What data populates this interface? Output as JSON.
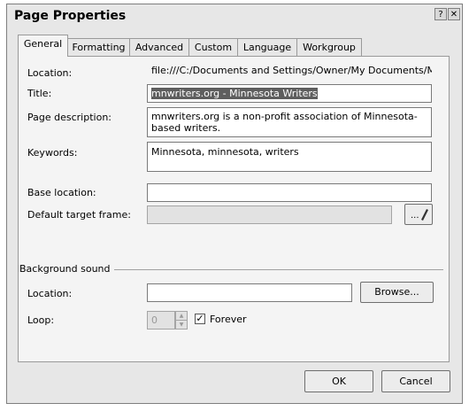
{
  "window": {
    "title": "Page Properties",
    "help_glyph": "?",
    "close_glyph": "✕"
  },
  "tabs": [
    {
      "label": "General"
    },
    {
      "label": "Formatting"
    },
    {
      "label": "Advanced"
    },
    {
      "label": "Custom"
    },
    {
      "label": "Language"
    },
    {
      "label": "Workgroup"
    }
  ],
  "general": {
    "location_label": "Location:",
    "location_value": "file:///C:/Documents and Settings/Owner/My Documents/My",
    "title_label": "Title:",
    "title_value": "mnwriters.org - Minnesota Writers",
    "description_label": "Page description:",
    "description_line1": "mnwriters.org is a non-profit association of Minnesota-",
    "description_line2": "based writers.",
    "keywords_label": "Keywords:",
    "keywords_value": "Minnesota, minnesota, writers",
    "base_location_label": "Base location:",
    "base_location_value": "",
    "target_frame_label": "Default target frame:",
    "target_frame_value": "",
    "target_frame_button": "..."
  },
  "background_sound": {
    "section_label": "Background sound",
    "location_label": "Location:",
    "location_value": "",
    "browse_button": "Browse...",
    "loop_label": "Loop:",
    "loop_value": "0",
    "forever_label": "Forever",
    "forever_checked": true
  },
  "footer": {
    "ok_label": "OK",
    "cancel_label": "Cancel"
  },
  "icons": {
    "pencil": "pencil-icon",
    "check": "checkmark-icon"
  }
}
